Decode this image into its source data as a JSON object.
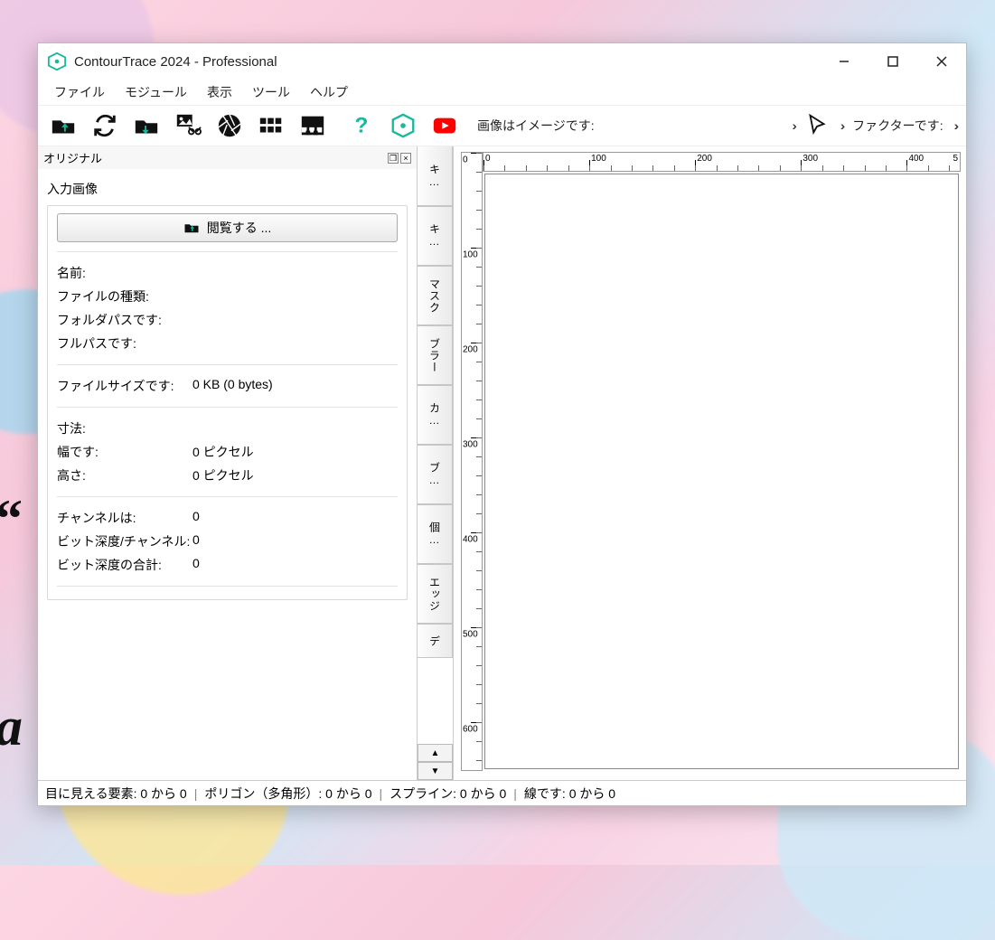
{
  "window": {
    "title": "ContourTrace 2024 - Professional"
  },
  "menu": {
    "file": "ファイル",
    "module": "モジュール",
    "view": "表示",
    "tool": "ツール",
    "help": "ヘルプ"
  },
  "toolbar": {
    "image_is_label": "画像はイメージです:",
    "factor_is_label": "ファクターです:"
  },
  "side_tabs": [
    "キ",
    "キ",
    "マスク",
    "ブラー",
    "カ",
    "ブ",
    "個",
    "エッジ",
    "デ"
  ],
  "panel": {
    "title": "オリジナル",
    "section": "入力画像",
    "browse": "閲覧する ...",
    "rows": {
      "name_k": "名前:",
      "name_v": "",
      "filetype_k": "ファイルの種類:",
      "filetype_v": "",
      "folder_k": "フォルダパスです:",
      "folder_v": "",
      "fullpath_k": "フルパスです:",
      "fullpath_v": "",
      "filesize_k": "ファイルサイズです:",
      "filesize_v": "0 KB (0 bytes)",
      "dims_k": "寸法:",
      "dims_v": "",
      "width_k": "幅です:",
      "width_v": "0 ピクセル",
      "height_k": "高さ:",
      "height_v": "0 ピクセル",
      "channels_k": "チャンネルは:",
      "channels_v": "0",
      "bdpc_k": "ビット深度/チャンネル:",
      "bdpc_v": "0",
      "bdtot_k": "ビット深度の合計:",
      "bdtot_v": "0"
    }
  },
  "ruler": {
    "h": [
      "0",
      "100",
      "200",
      "300",
      "400"
    ],
    "h_trail": "5",
    "v": [
      "0",
      "100",
      "200",
      "300",
      "400",
      "500",
      "600"
    ]
  },
  "status": {
    "visible": "目に見える要素: 0 から 0",
    "polygon": "ポリゴン（多角形）: 0 から 0",
    "spline": "スプライン: 0 から 0",
    "line": "線です: 0 から 0"
  },
  "colors": {
    "accent": "#19b79c",
    "youtube": "#ff0000"
  }
}
